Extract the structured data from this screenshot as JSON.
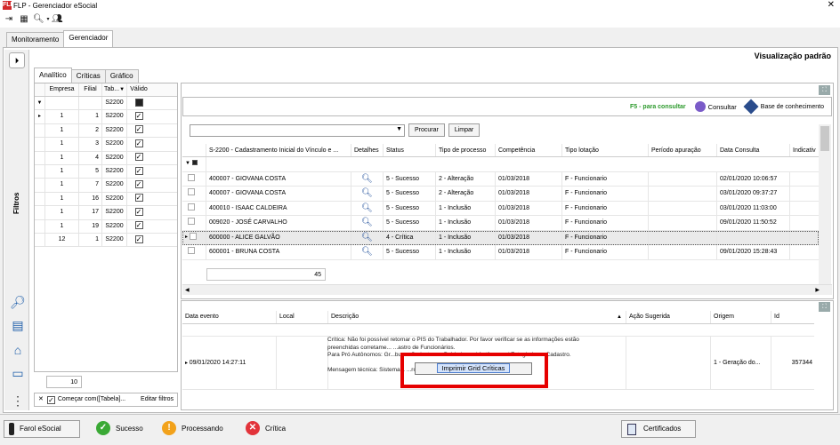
{
  "window": {
    "title": "FLP - Gerenciador eSocial",
    "app_icon": "FLP",
    "close": "✕"
  },
  "main_tabs": [
    {
      "label": "Monitoramento"
    },
    {
      "label": "Gerenciador"
    }
  ],
  "left_strip": {
    "label": "Filtros",
    "expand": "⏵"
  },
  "sub_tabs": [
    {
      "label": "Analítico"
    },
    {
      "label": "Críticas"
    },
    {
      "label": "Gráfico"
    }
  ],
  "filter_grid": {
    "headers": [
      "Empresa",
      "Filial",
      "Tab...",
      "Válido"
    ],
    "filter_row": {
      "tab": "S2200"
    },
    "rows": [
      {
        "empresa": "1",
        "filial": "1",
        "tab": "S2200"
      },
      {
        "empresa": "1",
        "filial": "2",
        "tab": "S2200"
      },
      {
        "empresa": "1",
        "filial": "3",
        "tab": "S2200"
      },
      {
        "empresa": "1",
        "filial": "4",
        "tab": "S2200"
      },
      {
        "empresa": "1",
        "filial": "5",
        "tab": "S2200"
      },
      {
        "empresa": "1",
        "filial": "7",
        "tab": "S2200"
      },
      {
        "empresa": "1",
        "filial": "16",
        "tab": "S2200"
      },
      {
        "empresa": "1",
        "filial": "17",
        "tab": "S2200"
      },
      {
        "empresa": "1",
        "filial": "19",
        "tab": "S2200"
      },
      {
        "empresa": "12",
        "filial": "1",
        "tab": "S2200"
      }
    ],
    "count": "10",
    "footer": "Começar com([Tabela]...",
    "edit_filters": "Editar filtros"
  },
  "view_label": "Visualização padrão",
  "info_bar": {
    "f5": "F5 - para consultar",
    "consultar": "Consultar",
    "base": "Base de conhecimento"
  },
  "search": {
    "procurar": "Procurar",
    "limpar": "Limpar"
  },
  "main_grid": {
    "headers": [
      "S-2200 - Cadastramento Inicial do Vínculo e ...",
      "Detalhes",
      "Status",
      "Tipo de processo",
      "Competência",
      "Tipo lotação",
      "Período apuração",
      "Data Consulta",
      "Indicativ"
    ],
    "rows": [
      {
        "name": "400007 - GIOVANA COSTA",
        "status": "5 - Sucesso",
        "tipo": "2 - Alteração",
        "comp": "01/03/2018",
        "lot": "F - Funcionario",
        "data": "02/01/2020 10:06:57"
      },
      {
        "name": "400007 - GIOVANA COSTA",
        "status": "5 - Sucesso",
        "tipo": "2 - Alteração",
        "comp": "01/03/2018",
        "lot": "F - Funcionario",
        "data": "03/01/2020 09:37:27"
      },
      {
        "name": "400010 - ISAAC CALDEIRA",
        "status": "5 - Sucesso",
        "tipo": "1 - Inclusão",
        "comp": "01/03/2018",
        "lot": "F - Funcionario",
        "data": "03/01/2020 11:03:00"
      },
      {
        "name": "009020 - JOSÉ CARVALHO",
        "status": "5 - Sucesso",
        "tipo": "1 - Inclusão",
        "comp": "01/03/2018",
        "lot": "F - Funcionario",
        "data": "09/01/2020 11:50:52"
      },
      {
        "name": "600000 - ALICE GALVÃO",
        "status": "4 - Crítica",
        "tipo": "1 - Inclusão",
        "comp": "01/03/2018",
        "lot": "F - Funcionario",
        "data": ""
      },
      {
        "name": "600001 - BRUNA COSTA",
        "status": "5 - Sucesso",
        "tipo": "1 - Inclusão",
        "comp": "01/03/2018",
        "lot": "F - Funcionario",
        "data": "09/01/2020 15:28:43"
      }
    ],
    "row_count": "45"
  },
  "bottom_grid": {
    "headers": [
      "Data evento",
      "Local",
      "Descrição",
      "Ação Sugerida",
      "Origem",
      "Id"
    ],
    "row": {
      "data_evento": "09/01/2020 14:27:11",
      "origem": "1 - Geração do...",
      "id": "357344"
    },
    "description_lines": [
      "Crítica: Não foi possível retornar o PIS do Trabalhador. Por favor verificar se as informações estão",
      "preenchidas corretame...                                                     ...astro de Funcionários.",
      "Para Pró Autônomos: Gr...bus > Cadastros > Pró Labores/ Autônomos/ Estagiarios > Cadastro.",
      "",
      "Mensagem técnica: Sistema...                                             ...ronxo."
    ]
  },
  "context_menu": {
    "item": "Imprimir Grid Críticas"
  },
  "status_bar": {
    "farol": "Farol eSocial",
    "sucesso": "Sucesso",
    "processando": "Processando",
    "critica": "Crítica",
    "certificados": "Certificados"
  },
  "colors": {
    "success": "#3aa935",
    "processing": "#f2a21b",
    "critical": "#e2333a",
    "highlight": "#e60000"
  }
}
